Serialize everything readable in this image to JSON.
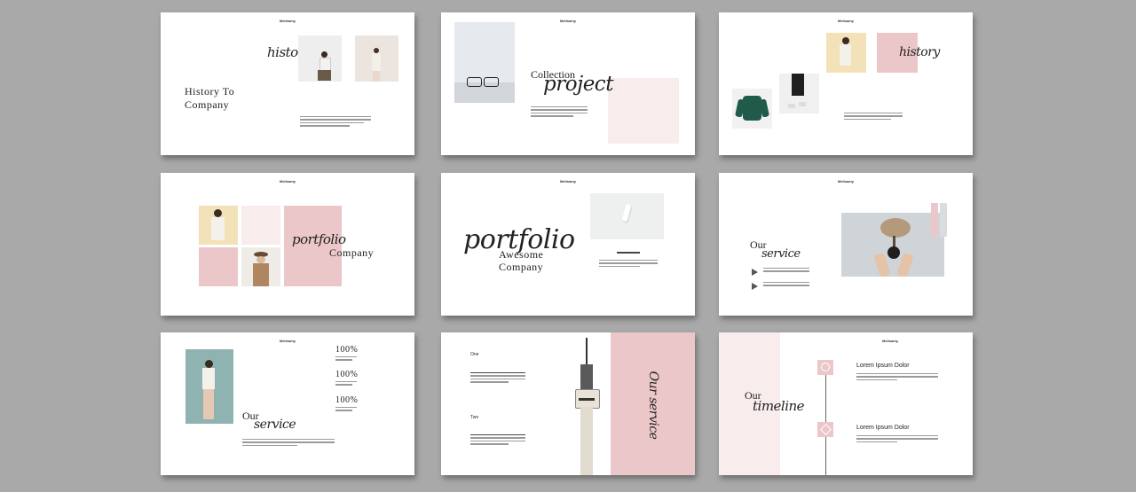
{
  "brand": "Melisamy",
  "slides": [
    {
      "script": "history",
      "title_line1": "History To",
      "title_line2": "Company"
    },
    {
      "title_line1": "Collection",
      "script": "project"
    },
    {
      "script": "history"
    },
    {
      "script": "portfolio",
      "title": "Company"
    },
    {
      "script": "portfolio",
      "title_line1": "Awesome",
      "title_line2": "Company"
    },
    {
      "title": "Our",
      "script": "service"
    },
    {
      "percents": [
        "100%",
        "100%",
        "100%"
      ],
      "title": "Our",
      "script": "service"
    },
    {
      "label_one": "One",
      "label_two": "Two",
      "script": "Our service"
    },
    {
      "title": "Our",
      "script": "timeline",
      "heading_1": "Lorem Ipsum Dolor",
      "heading_2": "Lorem Ipsum Dolor"
    }
  ],
  "colors": {
    "pink": "#ecc7c9",
    "light_pink": "#f8ecec",
    "background": "#a9a9a9",
    "teal": "#8fb3b0",
    "beige": "#f3e2b8"
  }
}
